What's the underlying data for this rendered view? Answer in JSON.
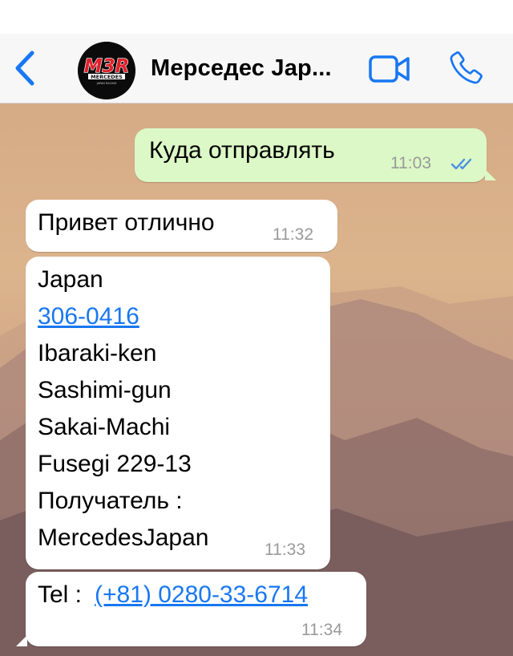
{
  "header": {
    "contact_name": "Мерседес Jap...",
    "avatar_logo_text": "M3R",
    "avatar_logo_subtext": "MERCEDES",
    "avatar_logo_small": "JAPAN RACING"
  },
  "messages": [
    {
      "direction": "outgoing",
      "text": "Куда отправлять",
      "time": "11:03",
      "status": "read",
      "status_color": "#4a90e2"
    },
    {
      "direction": "incoming",
      "text": "Привет отлично",
      "time": "11:32"
    },
    {
      "direction": "incoming",
      "lines": [
        "Japan",
        "306-0416",
        "Ibaraki-ken",
        "Sashimi-gun",
        "Sakai-Machi",
        "Fusegi 229-13",
        "Получатель :",
        "MercedesJapan"
      ],
      "time": "11:33"
    },
    {
      "direction": "incoming",
      "label": "Tel : ",
      "phone": "(+81) 0280-33-6714",
      "time": "11:34"
    }
  ],
  "colors": {
    "accent": "#1877f2",
    "outgoing_bubble": "#dcf8c6",
    "incoming_bubble": "#ffffff",
    "link": "#1877f2"
  }
}
